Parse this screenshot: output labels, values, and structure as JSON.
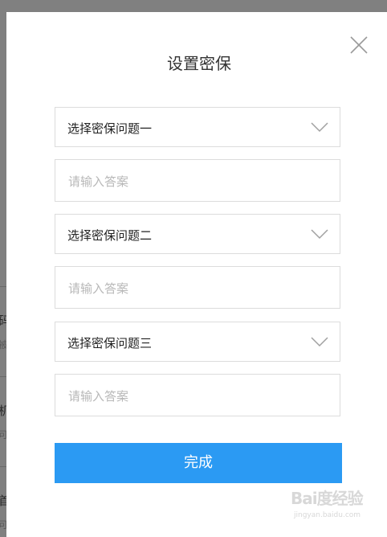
{
  "background": {
    "fragments": [
      "码",
      "被",
      "机",
      "可",
      "首",
      "可"
    ]
  },
  "dialog": {
    "title": "设置密保",
    "close_icon": "close-icon",
    "fields": [
      {
        "type": "select",
        "label": "选择密保问题一"
      },
      {
        "type": "input",
        "placeholder": "请输入答案"
      },
      {
        "type": "select",
        "label": "选择密保问题二"
      },
      {
        "type": "input",
        "placeholder": "请输入答案"
      },
      {
        "type": "select",
        "label": "选择密保问题三"
      },
      {
        "type": "input",
        "placeholder": "请输入答案"
      }
    ],
    "submit_label": "完成"
  },
  "watermark": {
    "main": "Bai度经验",
    "sub": "jingyan.baidu.com"
  },
  "colors": {
    "primary": "#2b9af3",
    "overlay": "#808080",
    "border": "#dcdcdc",
    "placeholder": "#b8b8b8"
  }
}
